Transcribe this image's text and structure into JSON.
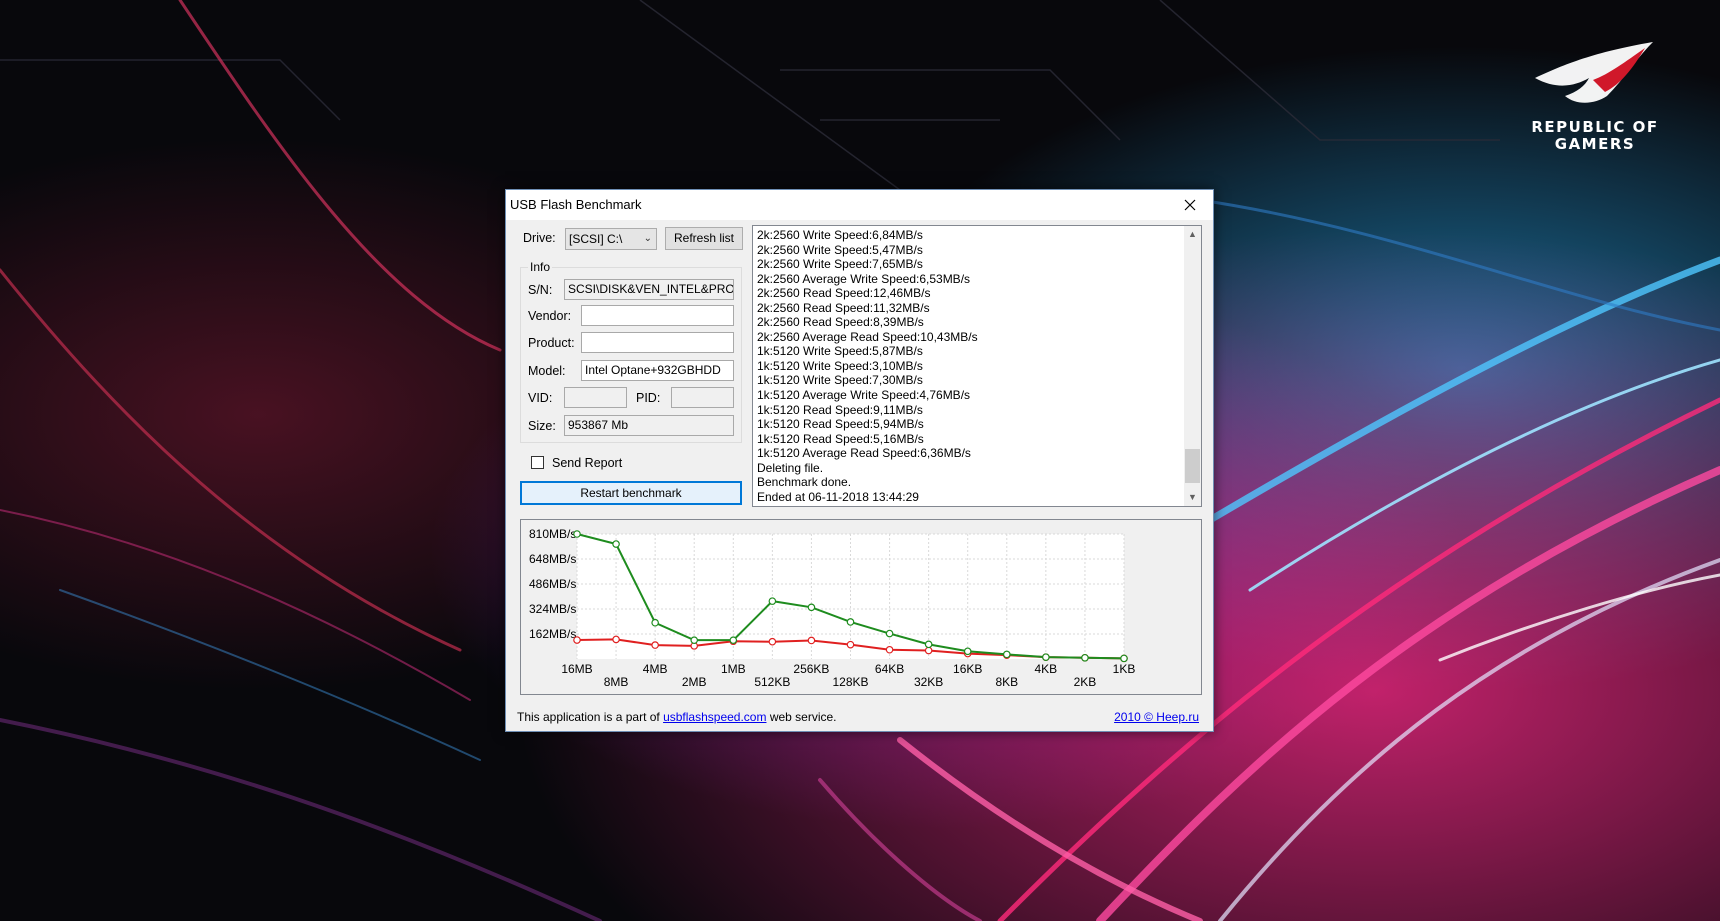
{
  "brand": {
    "line1": "REPUBLIC OF",
    "line2": "GAMERS"
  },
  "window": {
    "title": "USB Flash Benchmark"
  },
  "drive": {
    "label": "Drive:",
    "value": "[SCSI] C:\\",
    "refresh_label": "Refresh list"
  },
  "info": {
    "legend": "Info",
    "sn_label": "S/N:",
    "sn_value": "SCSI\\DISK&VEN_INTEL&PRO",
    "vendor_label": "Vendor:",
    "vendor_value": "",
    "product_label": "Product:",
    "product_value": "",
    "model_label": "Model:",
    "model_value": "Intel Optane+932GBHDD",
    "vid_label": "VID:",
    "vid_value": "",
    "pid_label": "PID:",
    "pid_value": "",
    "size_label": "Size:",
    "size_value": "953867 Mb"
  },
  "send_report": {
    "label": "Send Report",
    "checked": false
  },
  "restart_label": "Restart benchmark",
  "log_lines": [
    "2k:2560 Write Speed:6,84MB/s",
    "2k:2560 Write Speed:5,47MB/s",
    "2k:2560 Write Speed:7,65MB/s",
    "2k:2560 Average Write Speed:6,53MB/s",
    "2k:2560 Read Speed:12,46MB/s",
    "2k:2560 Read Speed:11,32MB/s",
    "2k:2560 Read Speed:8,39MB/s",
    "2k:2560 Average Read Speed:10,43MB/s",
    "1k:5120 Write Speed:5,87MB/s",
    "1k:5120 Write Speed:3,10MB/s",
    "1k:5120 Write Speed:7,30MB/s",
    "1k:5120 Average Write Speed:4,76MB/s",
    "1k:5120 Read Speed:9,11MB/s",
    "1k:5120 Read Speed:5,94MB/s",
    "1k:5120 Read Speed:5,16MB/s",
    "1k:5120 Average Read Speed:6,36MB/s",
    "Deleting file.",
    "Benchmark done.",
    "Ended at 06-11-2018 13:44:29"
  ],
  "chart_data": {
    "type": "line",
    "title": "",
    "xlabel": "",
    "ylabel": "",
    "ylim": [
      0,
      810
    ],
    "y_ticks": [
      "810MB/s",
      "648MB/s",
      "486MB/s",
      "324MB/s",
      "162MB/s"
    ],
    "y_tick_values": [
      810,
      648,
      486,
      324,
      162
    ],
    "categories": [
      "16MB",
      "8MB",
      "4MB",
      "2MB",
      "1MB",
      "512KB",
      "256KB",
      "128KB",
      "64KB",
      "32KB",
      "16KB",
      "8KB",
      "4KB",
      "2KB",
      "1KB"
    ],
    "grid": true,
    "legend": "none",
    "series": [
      {
        "color": "#1e8c1e",
        "values": [
          810,
          745,
          235,
          122,
          122,
          375,
          335,
          240,
          165,
          95,
          50,
          30,
          12,
          8,
          4
        ]
      },
      {
        "color": "#e02020",
        "values": [
          123,
          127,
          90,
          85,
          115,
          112,
          120,
          93,
          60,
          55,
          35,
          25,
          12,
          8,
          4
        ]
      }
    ]
  },
  "footer": {
    "prefix": "This application is a part of ",
    "link": "usbflashspeed.com",
    "suffix": " web service.",
    "right_link": "2010 © Heep.ru"
  }
}
